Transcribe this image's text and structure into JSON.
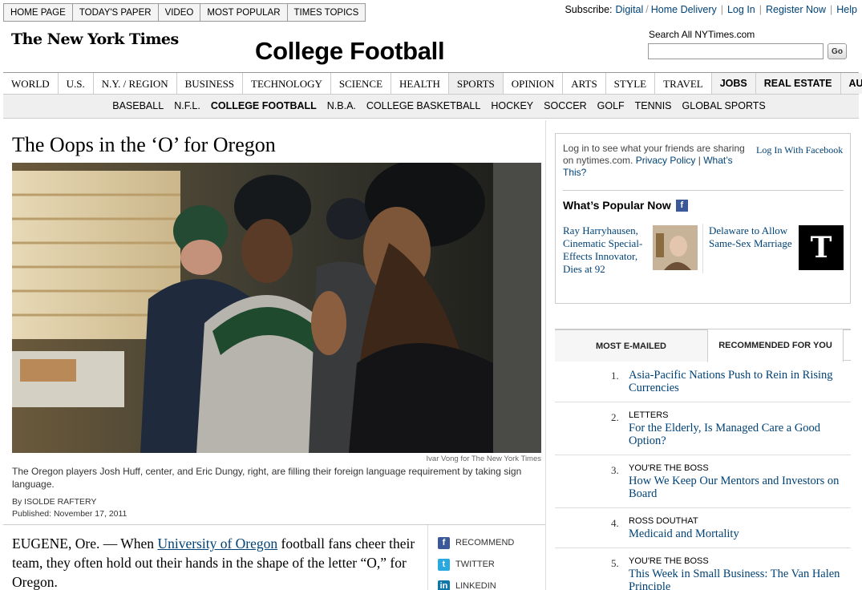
{
  "topnav": [
    "HOME PAGE",
    "TODAY'S PAPER",
    "VIDEO",
    "MOST POPULAR",
    "TIMES TOPICS"
  ],
  "util": {
    "subscribe_label": "Subscribe:",
    "digital": "Digital",
    "home_delivery": "Home Delivery",
    "login": "Log In",
    "register": "Register Now",
    "help": "Help"
  },
  "logo": "The New York Times",
  "section_title": "College Football",
  "search": {
    "label": "Search All NYTimes.com",
    "go": "Go",
    "value": ""
  },
  "secnav": [
    {
      "label": "WORLD",
      "style": "serif"
    },
    {
      "label": "U.S.",
      "style": "serif"
    },
    {
      "label": "N.Y. / REGION",
      "style": "serif"
    },
    {
      "label": "BUSINESS",
      "style": "serif"
    },
    {
      "label": "TECHNOLOGY",
      "style": "serif"
    },
    {
      "label": "SCIENCE",
      "style": "serif"
    },
    {
      "label": "HEALTH",
      "style": "serif"
    },
    {
      "label": "SPORTS",
      "style": "active"
    },
    {
      "label": "OPINION",
      "style": "serif"
    },
    {
      "label": "ARTS",
      "style": "serif"
    },
    {
      "label": "STYLE",
      "style": "serif"
    },
    {
      "label": "TRAVEL",
      "style": "serif"
    },
    {
      "label": "JOBS",
      "style": "sans"
    },
    {
      "label": "REAL ESTATE",
      "style": "sans"
    },
    {
      "label": "AUTOS",
      "style": "sans"
    }
  ],
  "subnav": [
    "BASEBALL",
    "N.F.L.",
    "COLLEGE FOOTBALL",
    "N.B.A.",
    "COLLEGE BASKETBALL",
    "HOCKEY",
    "SOCCER",
    "GOLF",
    "TENNIS",
    "GLOBAL SPORTS"
  ],
  "subnav_active": "COLLEGE FOOTBALL",
  "article": {
    "headline": "The Oops in the ‘O’ for Oregon",
    "photo_credit": "Ivar Vong for The New York Times",
    "caption": "The Oregon players Josh Huff, center, and Eric Dungy, right, are filling their foreign language requirement by taking sign language.",
    "byline": "By ISOLDE RAFTERY",
    "published": "Published: November 17, 2011",
    "lede_before": "EUGENE, Ore. — When ",
    "lede_link": "University of Oregon",
    "lede_after": " football fans cheer their team, they often hold out their hands in the shape of the letter “O,” for Oregon."
  },
  "share": [
    {
      "label": "RECOMMEND",
      "icon": "facebook-icon",
      "glyph": "f",
      "color": "#3b5998"
    },
    {
      "label": "TWITTER",
      "icon": "twitter-icon",
      "glyph": "t",
      "color": "#2aa9e0"
    },
    {
      "label": "LINKEDIN",
      "icon": "linkedin-icon",
      "glyph": "in",
      "color": "#0e76a8"
    }
  ],
  "facebook": {
    "login_text": "Log in to see what your friends are sharing on nytimes.com.",
    "privacy": "Privacy Policy",
    "pipe": "|",
    "whats_this": "What’s This?",
    "login_button": "Log In With Facebook",
    "popular_title": "What’s Popular Now",
    "popular": [
      {
        "title": "Ray Harryhausen, Cinematic Special-Effects Innovator, Dies at 92"
      },
      {
        "title": "Delaware to Allow Same-Sex Marriage",
        "thumb_glyph": "T"
      }
    ]
  },
  "tabs": [
    "MOST E-MAILED",
    "RECOMMENDED FOR YOU"
  ],
  "recommended": [
    {
      "num": "1.",
      "kicker": "",
      "title": "Asia-Pacific Nations Push to Rein in Rising Currencies"
    },
    {
      "num": "2.",
      "kicker": "LETTERS",
      "title": "For the Elderly, Is Managed Care a Good Option?"
    },
    {
      "num": "3.",
      "kicker": "YOU'RE THE BOSS",
      "title": "How We Keep Our Mentors and Investors on Board"
    },
    {
      "num": "4.",
      "kicker": "ROSS DOUTHAT",
      "title": "Medicaid and Mortality"
    },
    {
      "num": "5.",
      "kicker": "YOU'RE THE BOSS",
      "title": "This Week in Small Business: The Van Halen Principle"
    }
  ]
}
